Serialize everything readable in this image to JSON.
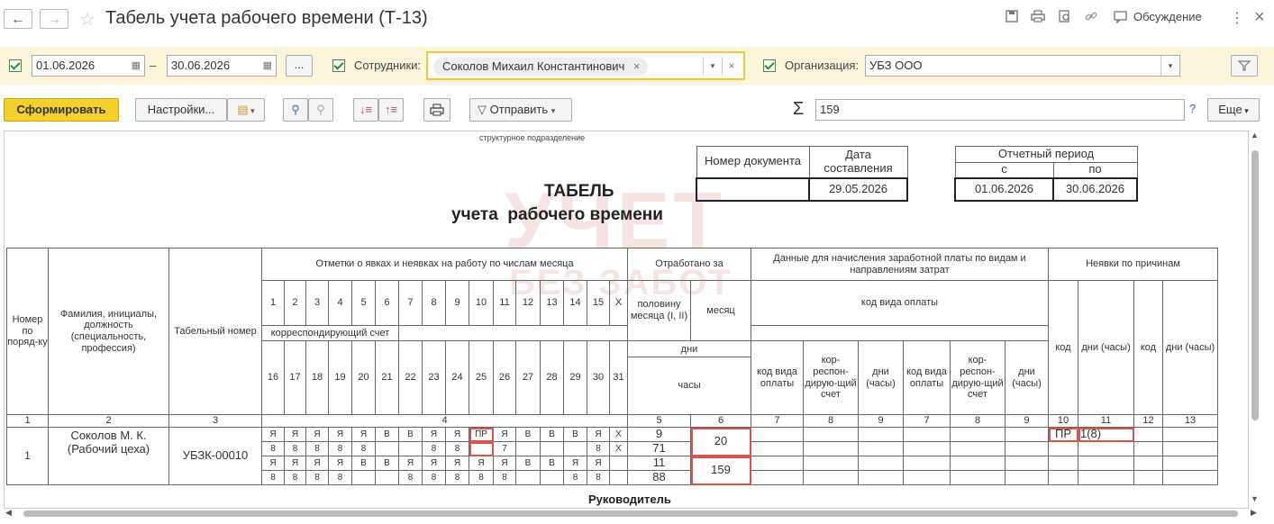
{
  "titlebar": {
    "title": "Табель учета рабочего времени (Т-13)",
    "back_icon": "arrow-left-icon",
    "forward_icon": "arrow-right-icon",
    "star_icon": "star-icon",
    "discussion_label": "Обсуждение",
    "more_label": "⋮",
    "close_label": "×"
  },
  "filters": {
    "date_from": "01.06.2026",
    "dash": "–",
    "date_to": "30.06.2026",
    "dots": "...",
    "employees_label": "Сотрудники:",
    "employee_chip": "Соколов Михаил Константинович",
    "organization_label": "Организация:",
    "organization_value": "УБЗ ООО"
  },
  "commands": {
    "generate": "Сформировать",
    "settings": "Настройки...",
    "send": "Отправить",
    "sigma": "Σ",
    "sum_value": "159",
    "help": "?",
    "more": "Еще"
  },
  "report": {
    "struct_unit": "структурное подразделение",
    "title1": "ТАБЕЛЬ",
    "title2": "учета  рабочего времени",
    "doc_number_header": "Номер документа",
    "doc_date_header": "Дата составления",
    "doc_number": "",
    "doc_date": "29.05.2026",
    "period_header": "Отчетный период",
    "period_from_header": "с",
    "period_to_header": "по",
    "period_from": "01.06.2026",
    "period_to": "30.06.2026",
    "watermark1": "УЧЕТ",
    "watermark2": "БЕЗ ЗАБОТ",
    "footer": "Руководитель"
  },
  "grid": {
    "h_num": "Номер по поряд-ку",
    "h_name": "Фамилия, инициалы, должность (специальность, профессия)",
    "h_tab": "Табельный номер",
    "h_marks": "Отметки о явках и неявках на работу по числам месяца",
    "h_worked": "Отработано за",
    "h_half": "половину месяца (I, II)",
    "h_month": "месяц",
    "h_days": "дни",
    "h_hours": "часы",
    "h_pay": "Данные для начисления заработной платы по видам и направлениям затрат",
    "h_paycode": "код вида оплаты",
    "h_account": "корреспондирующий счет",
    "h_c_code": "код вида оплаты",
    "h_c_acc": "кор-респон-дирую-щий счет",
    "h_c_days": "дни (часы)",
    "h_absence": "Неявки по причинам",
    "h_a_code": "код",
    "h_a_days": "дни (часы)",
    "days_row1": [
      "1",
      "2",
      "3",
      "4",
      "5",
      "6",
      "7",
      "8",
      "9",
      "10",
      "11",
      "12",
      "13",
      "14",
      "15",
      "X"
    ],
    "days_row2": [
      "16",
      "17",
      "18",
      "19",
      "20",
      "21",
      "22",
      "23",
      "24",
      "25",
      "26",
      "27",
      "28",
      "29",
      "30",
      "31"
    ],
    "colnums": [
      "1",
      "2",
      "3",
      "4",
      "5",
      "6",
      "7",
      "8",
      "9",
      "7",
      "8",
      "9",
      "10",
      "11",
      "12",
      "13"
    ],
    "employee_num": "1",
    "employee_name": "Соколов М. К. (Рабочий цеха)",
    "employee_tab": "УБЗК-00010",
    "r1_marks": [
      "Я",
      "Я",
      "Я",
      "Я",
      "Я",
      "В",
      "В",
      "Я",
      "Я",
      "ПР",
      "Я",
      "В",
      "В",
      "В",
      "Я",
      "X"
    ],
    "r2_hours": [
      "8",
      "8",
      "8",
      "8",
      "8",
      "",
      "",
      "8",
      "8",
      "",
      "7",
      "",
      "",
      "",
      "8",
      "X"
    ],
    "r3_marks": [
      "Я",
      "Я",
      "Я",
      "Я",
      "В",
      "В",
      "Я",
      "Я",
      "Я",
      "Я",
      "Я",
      "В",
      "В",
      "Я",
      "Я",
      ""
    ],
    "r4_hours": [
      "8",
      "8",
      "8",
      "8",
      "",
      "",
      "8",
      "8",
      "8",
      "8",
      "8",
      "",
      "",
      "8",
      "8",
      ""
    ],
    "half1_days": "9",
    "half1_hours": "71",
    "half2_days": "11",
    "half2_hours": "88",
    "month_days": "20",
    "month_hours": "159",
    "abs_code": "ПР",
    "abs_days": "1(8)"
  }
}
